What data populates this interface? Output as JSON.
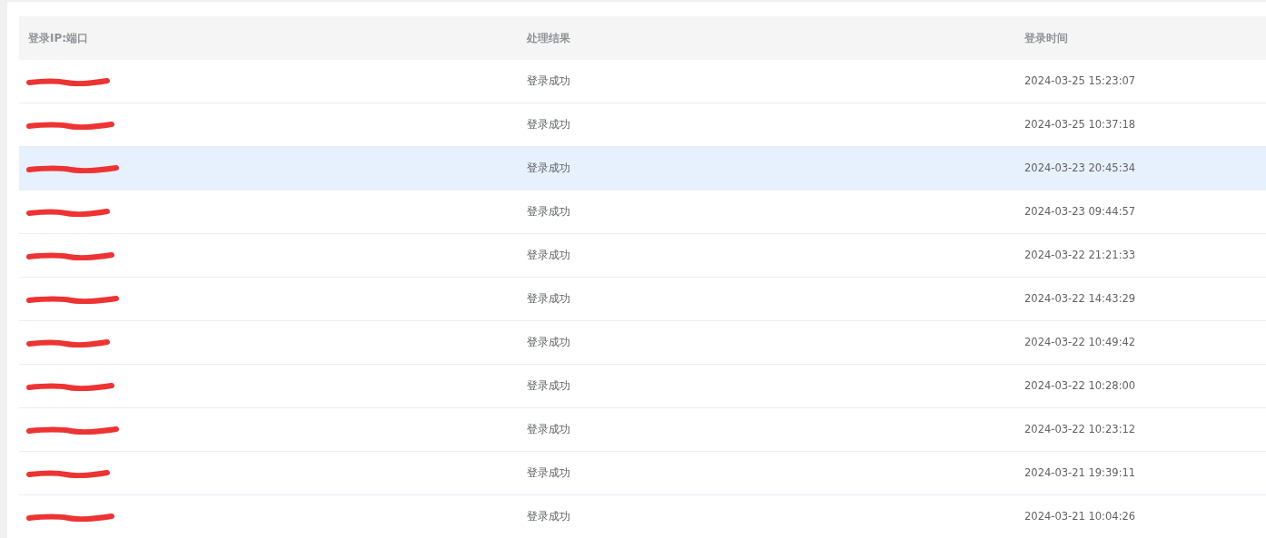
{
  "table": {
    "columns": [
      "登录IP:端口",
      "处理结果",
      "登录时间"
    ],
    "rows": [
      {
        "ip_redacted": true,
        "result": "登录成功",
        "time": "2024-03-25 15:23:07",
        "hovered": false
      },
      {
        "ip_redacted": true,
        "result": "登录成功",
        "time": "2024-03-25 10:37:18",
        "hovered": false
      },
      {
        "ip_redacted": true,
        "result": "登录成功",
        "time": "2024-03-23 20:45:34",
        "hovered": true
      },
      {
        "ip_redacted": true,
        "result": "登录成功",
        "time": "2024-03-23 09:44:57",
        "hovered": false
      },
      {
        "ip_redacted": true,
        "result": "登录成功",
        "time": "2024-03-22 21:21:33",
        "hovered": false
      },
      {
        "ip_redacted": true,
        "result": "登录成功",
        "time": "2024-03-22 14:43:29",
        "hovered": false
      },
      {
        "ip_redacted": true,
        "result": "登录成功",
        "time": "2024-03-22 10:49:42",
        "hovered": false
      },
      {
        "ip_redacted": true,
        "result": "登录成功",
        "time": "2024-03-22 10:28:00",
        "hovered": false
      },
      {
        "ip_redacted": true,
        "result": "登录成功",
        "time": "2024-03-22 10:23:12",
        "hovered": false
      },
      {
        "ip_redacted": true,
        "result": "登录成功",
        "time": "2024-03-21 19:39:11",
        "hovered": false
      },
      {
        "ip_redacted": true,
        "result": "登录成功",
        "time": "2024-03-21 10:04:26",
        "hovered": false
      }
    ]
  }
}
